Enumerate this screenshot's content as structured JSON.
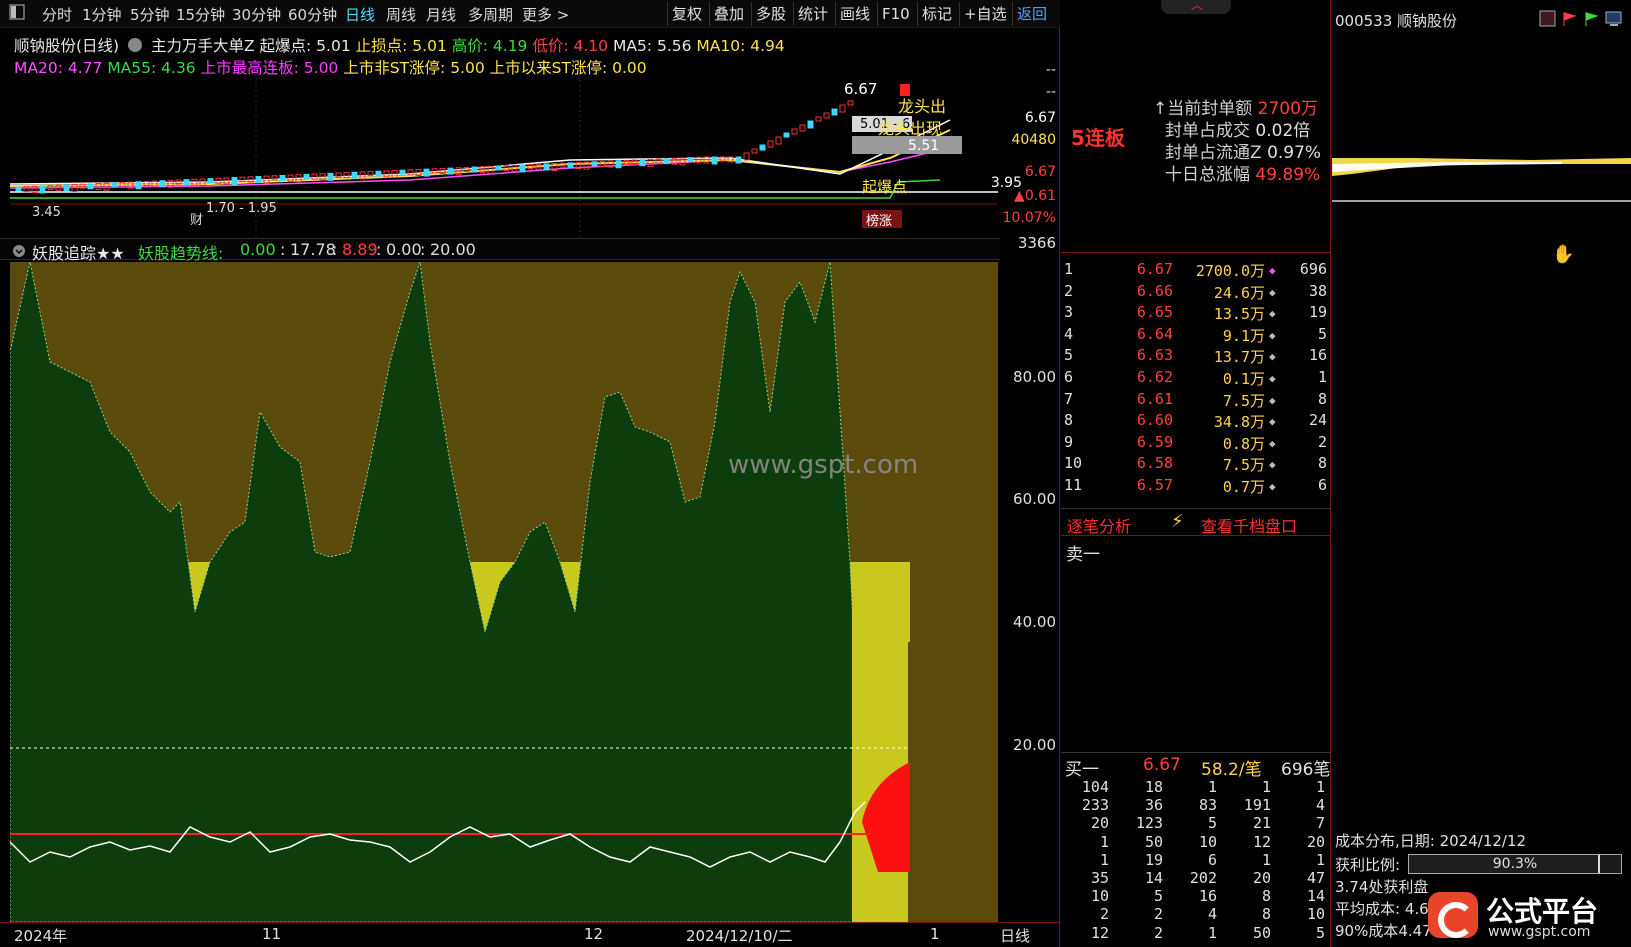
{
  "toolbar": {
    "periods": [
      "分时",
      "1分钟",
      "5分钟",
      "15分钟",
      "30分钟",
      "60分钟",
      "日线",
      "周线",
      "月线",
      "多周期",
      "更多 >"
    ],
    "active_period": "日线",
    "tools": [
      "复权",
      "叠加",
      "多股",
      "统计",
      "画线",
      "F10",
      "标记",
      "+自选",
      "返回"
    ]
  },
  "indicators": {
    "line1": [
      {
        "text": "顺钠股份(日线)",
        "color": "#e8e8e8"
      },
      {
        "text": "主力万手大单Z 起爆点: 5.01",
        "color": "#e8e8e8"
      },
      {
        "text": "止损点: 5.01",
        "color": "#ffe14a"
      },
      {
        "text": "高价: 4.19",
        "color": "#3cdc3c"
      },
      {
        "text": "低价: 4.10",
        "color": "#ff4040"
      },
      {
        "text": "MA5: 5.56",
        "color": "#e8e8e8"
      },
      {
        "text": "MA10: 4.94",
        "color": "#ffe14a"
      }
    ],
    "line2": [
      {
        "text": "MA20: 4.77",
        "color": "#ff4dff"
      },
      {
        "text": "MA55: 4.36",
        "color": "#3cdc3c"
      },
      {
        "text": "上市最高连板: 5.00",
        "color": "#ff3cff"
      },
      {
        "text": "上市非ST涨停: 5.00",
        "color": "#ffe14a"
      },
      {
        "text": "上市以来ST涨停: 0.00",
        "color": "#ffe14a"
      }
    ]
  },
  "kchart": {
    "labels": {
      "high_price": "6.67",
      "ma_box": "5.51",
      "breakout_box": "5.01 - 6.01",
      "dragon_1": "龙头出",
      "dragon_2": "龙头出现",
      "qibao": "起爆点",
      "low_note": "3.45",
      "cai": "财",
      "range_note": "1.70 - 1.95",
      "limit_up": "榜涨"
    },
    "axis": {
      "dash1": "--",
      "dash2": "--",
      "price_high": "6.67",
      "volume": "40480",
      "prev": "6.67",
      "left_price": "3.95",
      "change": "▲0.61",
      "change_pct": "10.07%"
    },
    "colors": {
      "up": "#ff3030",
      "down": "#3cd8ff",
      "ma5": "#ffffff",
      "ma10": "#ffe14a",
      "ma20": "#ff4dff",
      "ma55": "#3cdc3c"
    }
  },
  "sub": {
    "title": "妖股追踪★★",
    "trend_label": "妖股趋势线:",
    "v1": "0.00",
    "v2": "17.78",
    "v3": "8.89",
    "v4": "0.00",
    "v5": "20.00",
    "axis_top": "3366",
    "axis_ticks": [
      "80.00",
      "60.00",
      "40.00",
      "20.00"
    ]
  },
  "xaxis": {
    "labels": [
      "2024年",
      "11",
      "12",
      "2024/12/10/二",
      "1"
    ],
    "period": "日线"
  },
  "watermark": "www.gspt.com",
  "midpanel": {
    "lianban": "5连板",
    "seal": [
      {
        "label": "↑当前封单额",
        "value": "2700万"
      },
      {
        "label": "封单占成交",
        "value": "0.02倍"
      },
      {
        "label": "封单占流通Z",
        "value": "0.97%"
      },
      {
        "label": "十日总涨幅",
        "value": "49.89%"
      }
    ],
    "orderbook": [
      {
        "i": "1",
        "p": "6.67",
        "a": "2700.0万",
        "c": "696"
      },
      {
        "i": "2",
        "p": "6.66",
        "a": "24.6万",
        "c": "38"
      },
      {
        "i": "3",
        "p": "6.65",
        "a": "13.5万",
        "c": "19"
      },
      {
        "i": "4",
        "p": "6.64",
        "a": "9.1万",
        "c": "5"
      },
      {
        "i": "5",
        "p": "6.63",
        "a": "13.7万",
        "c": "16"
      },
      {
        "i": "6",
        "p": "6.62",
        "a": "0.1万",
        "c": "1"
      },
      {
        "i": "7",
        "p": "6.61",
        "a": "7.5万",
        "c": "8"
      },
      {
        "i": "8",
        "p": "6.60",
        "a": "34.8万",
        "c": "24"
      },
      {
        "i": "9",
        "p": "6.59",
        "a": "0.8万",
        "c": "2"
      },
      {
        "i": "10",
        "p": "6.58",
        "a": "7.5万",
        "c": "8"
      },
      {
        "i": "11",
        "p": "6.57",
        "a": "0.7万",
        "c": "6"
      }
    ],
    "tabs": {
      "tick": "逐笔分析",
      "depth": "查看千档盘口"
    },
    "sell1": "卖一",
    "buy1": {
      "label": "买一",
      "price": "6.67",
      "avg": "58.2/笔",
      "count": "696笔"
    },
    "ticks": [
      [
        "104",
        "18",
        "1",
        "1",
        "1"
      ],
      [
        "233",
        "36",
        "83",
        "191",
        "4"
      ],
      [
        "20",
        "123",
        "5",
        "21",
        "7"
      ],
      [
        "1",
        "50",
        "10",
        "12",
        "20"
      ],
      [
        "1",
        "19",
        "6",
        "1",
        "1"
      ],
      [
        "35",
        "14",
        "202",
        "20",
        "47"
      ],
      [
        "10",
        "5",
        "16",
        "8",
        "14"
      ],
      [
        "2",
        "2",
        "4",
        "8",
        "10"
      ],
      [
        "12",
        "2",
        "1",
        "50",
        "5"
      ]
    ]
  },
  "rightpanel": {
    "stock": "000533 顺钠股份",
    "cost_date": "成本分布,日期: 2024/12/12",
    "profit_label": "获利比例:",
    "profit_pct": "90.3%",
    "profit_value": 0.903,
    "profit_at": "3.74处获利盘",
    "avg_cost": "平均成本: 4.6",
    "cost90": "90%成本4.47"
  },
  "logo": {
    "title": "公式平台",
    "url": "www.gspt.com"
  }
}
